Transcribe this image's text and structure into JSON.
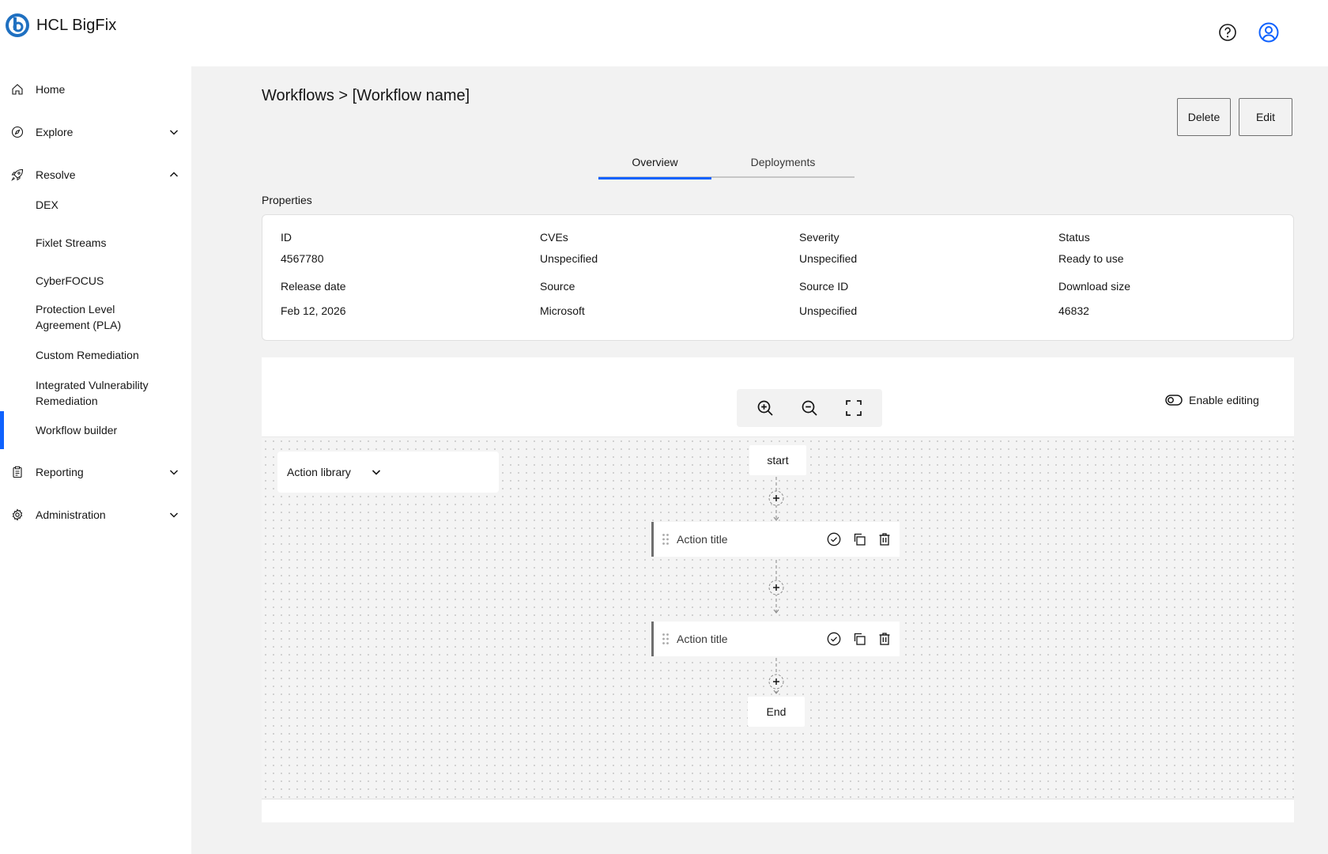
{
  "header": {
    "brand": "HCL BigFix",
    "icons": [
      "help-icon",
      "user-icon"
    ]
  },
  "sidebar": {
    "items": [
      {
        "label": "Home",
        "icon": "home-icon"
      },
      {
        "label": "Explore",
        "icon": "compass-icon",
        "expanded": false
      },
      {
        "label": "Resolve",
        "icon": "rocket-icon",
        "expanded": true
      },
      {
        "label": "Reporting",
        "icon": "clipboard-icon",
        "expanded": false
      },
      {
        "label": "Administration",
        "icon": "gear-icon",
        "expanded": false
      }
    ],
    "resolve_subitems": [
      {
        "label": "DEX"
      },
      {
        "label": "Fixlet Streams"
      },
      {
        "label": "CyberFOCUS"
      },
      {
        "label": "Protection Level",
        "label2": "Agreement (PLA)"
      },
      {
        "label": "Custom Remediation"
      },
      {
        "label": "Integrated Vulnerability",
        "label2": "Remediation"
      },
      {
        "label": "Workflow builder",
        "active": true
      }
    ],
    "accent_color": "#0f62fe"
  },
  "page": {
    "title": "Workflows > [Workflow name]",
    "buttons": {
      "delete": "Delete",
      "edit": "Edit"
    },
    "tabs": [
      {
        "label": "Overview",
        "selected": true
      },
      {
        "label": "Deployments",
        "selected": false
      }
    ],
    "properties_label": "Properties",
    "properties": [
      {
        "label": "ID",
        "value": "4567780"
      },
      {
        "label": "CVEs",
        "value": "Unspecified"
      },
      {
        "label": "Severity",
        "value": "Unspecified"
      },
      {
        "label": "Status",
        "value": "Ready to use"
      },
      {
        "label": "Release date",
        "value": "Feb 12, 2026"
      },
      {
        "label": "Source",
        "value": "Microsoft"
      },
      {
        "label": "Source ID",
        "value": "Unspecified"
      },
      {
        "label": "Download size",
        "value": "46832"
      }
    ]
  },
  "workflow": {
    "toolbar": [
      "zoom-in-icon",
      "zoom-out-icon",
      "fit-to-screen-icon"
    ],
    "enable_editing": "Enable editing",
    "action_library": "Action library",
    "start": "start",
    "end": "End",
    "actions": [
      {
        "title": "Action title"
      },
      {
        "title": "Action title"
      }
    ]
  }
}
